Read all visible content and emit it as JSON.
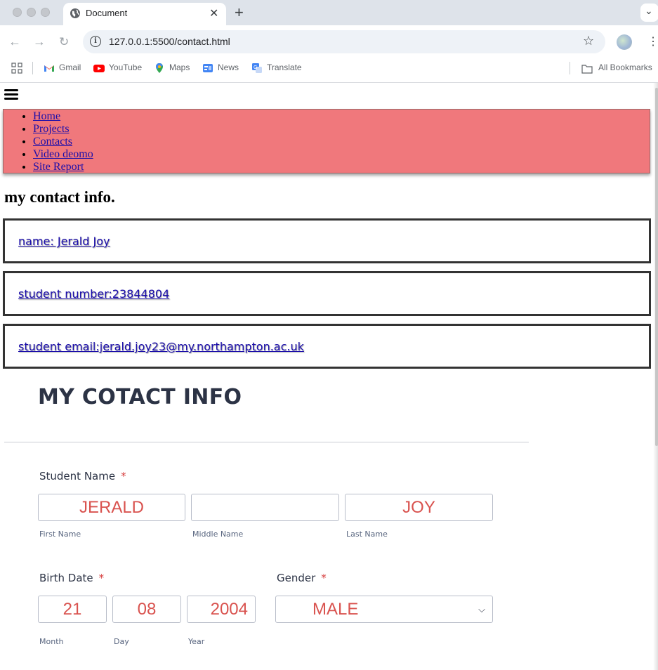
{
  "browser": {
    "tab_title": "Document",
    "url": "127.0.0.1:5500/contact.html",
    "bookmarks": [
      {
        "label": "Gmail",
        "icon": "gmail-icon"
      },
      {
        "label": "YouTube",
        "icon": "youtube-icon"
      },
      {
        "label": "Maps",
        "icon": "maps-icon"
      },
      {
        "label": "News",
        "icon": "news-icon"
      },
      {
        "label": "Translate",
        "icon": "translate-icon"
      }
    ],
    "all_bookmarks": "All Bookmarks"
  },
  "nav": {
    "items": [
      "Home",
      "Projects",
      "Contacts",
      "Video deomo",
      "Site Report"
    ],
    "bg_color": "#f0787c"
  },
  "contact": {
    "heading": "my contact info.",
    "name": "name: Jerald Joy",
    "student_number": "student number:23844804",
    "email": "student email:jerald.joy23@my.northampton.ac.uk"
  },
  "form": {
    "title": "MY COTACT INFO",
    "student_name": {
      "label": "Student Name",
      "required": "*",
      "first": {
        "value": "JERALD",
        "sublabel": "First Name"
      },
      "middle": {
        "value": "",
        "sublabel": "Middle Name"
      },
      "last": {
        "value": "JOY",
        "sublabel": "Last Name"
      }
    },
    "birth_date": {
      "label": "Birth Date",
      "required": "*",
      "month": {
        "value": "21",
        "sublabel": "Month"
      },
      "day": {
        "value": "08",
        "sublabel": "Day"
      },
      "year": {
        "value": "2004",
        "sublabel": "Year"
      }
    },
    "gender": {
      "label": "Gender",
      "required": "*",
      "value": "MALE"
    },
    "accent_color": "#d9534f"
  }
}
